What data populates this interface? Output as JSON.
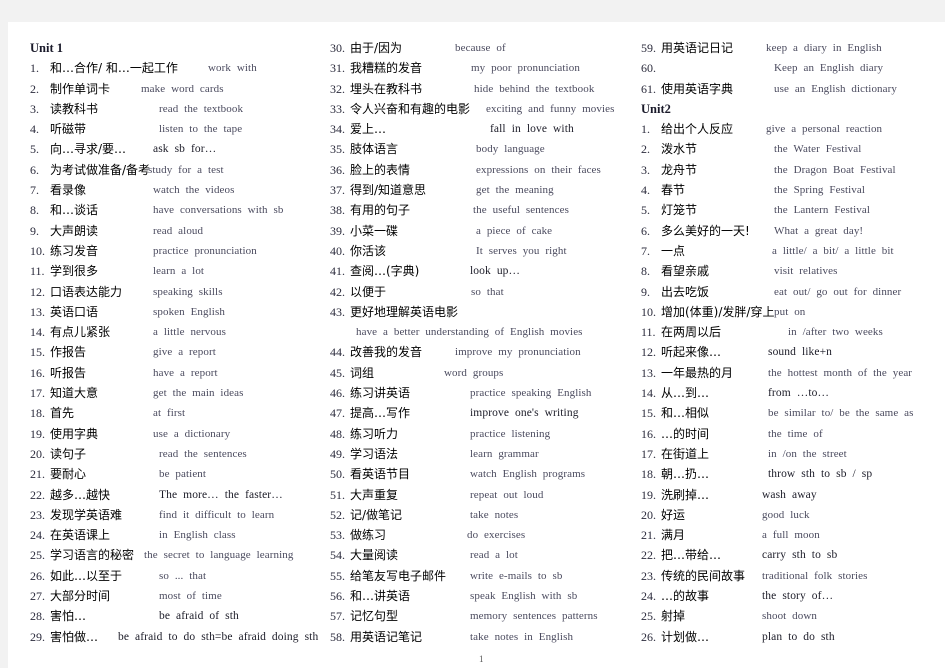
{
  "page": {
    "page_number": "1",
    "columns": [
      {
        "lines": [
          {
            "type": "heading",
            "text": "Unit  1"
          },
          {
            "n": "1.",
            "zh": "和…合作/ 和…一起工作",
            "en": "work  with"
          },
          {
            "n": "2.",
            "zh": "制作单词卡",
            "en": "make  word  cards"
          },
          {
            "n": "3.",
            "zh": "读教科书",
            "en": "read  the  textbook"
          },
          {
            "n": "4.",
            "zh": "听磁带",
            "en": "listen  to  the  tape"
          },
          {
            "n": "5.",
            "zh": "向…寻求/要…",
            "en": "ask  sb  for…",
            "dark": true
          },
          {
            "n": "6.",
            "zh": "为考试做准备/备考",
            "en": "study  for  a  test"
          },
          {
            "n": "7.",
            "zh": "看录像",
            "en": "watch  the  videos"
          },
          {
            "n": "8.",
            "zh": "和…谈话",
            "en": "have  conversations  with  sb"
          },
          {
            "n": "9.",
            "zh": "大声朗读",
            "en": "read  aloud"
          },
          {
            "n": "10.",
            "zh": "练习发音",
            "en": "practice  pronunciation"
          },
          {
            "n": "11.",
            "zh": "学到很多",
            "en": "learn  a  lot"
          },
          {
            "n": "12.",
            "zh": "口语表达能力",
            "en": "speaking  skills"
          },
          {
            "n": "13.",
            "zh": "英语口语",
            "en": "spoken  English"
          },
          {
            "n": "14.",
            "zh": "有点儿紧张",
            "en": "a  little  nervous"
          },
          {
            "n": "15.",
            "zh": "作报告",
            "en": "give  a  report"
          },
          {
            "n": "16.",
            "zh": "听报告",
            "en": "have  a  report"
          },
          {
            "n": "17.",
            "zh": "知道大意",
            "en": "get  the  main  ideas"
          },
          {
            "n": "18.",
            "zh": "首先",
            "en": "at  first"
          },
          {
            "n": "19.",
            "zh": "使用字典",
            "en": "use  a  dictionary"
          },
          {
            "n": "20.",
            "zh": "读句子",
            "en": "read  the  sentences"
          },
          {
            "n": "21.",
            "zh": "要耐心",
            "en": "be  patient"
          },
          {
            "n": "22.",
            "zh": "越多…越快",
            "en": "The  more…  the  faster…",
            "dark": true
          },
          {
            "n": "23.",
            "zh": "发现学英语难",
            "en": "find  it  difficult  to  learn"
          },
          {
            "n": "24.",
            "zh": "在英语课上",
            "en": "in  English  class"
          },
          {
            "n": "25.",
            "zh": "学习语言的秘密",
            "en": "the  secret  to  language  learning"
          },
          {
            "n": "26.",
            "zh": "如此…以至于",
            "en": "so  ...  that"
          },
          {
            "n": "27.",
            "zh": "大部分时间",
            "en": "most  of  time"
          },
          {
            "n": "28.",
            "zh": "害怕…",
            "en": "be  afraid  of  sth",
            "dark": true
          },
          {
            "n": "29.",
            "zh": "害怕做…",
            "en": "be  afraid  to  do  sth=be  afraid  doing  sth",
            "dark": true
          }
        ]
      },
      {
        "lines": [
          {
            "n": "30.",
            "zh": "由于/因为",
            "en": "because  of"
          },
          {
            "n": "31.",
            "zh": "我糟糕的发音",
            "en": "my  poor  pronunciation"
          },
          {
            "n": "32.",
            "zh": "埋头在教科书",
            "en": "hide  behind  the  textbook"
          },
          {
            "n": "33.",
            "zh": "令人兴奋和有趣的电影",
            "en": "exciting  and  funny  movies"
          },
          {
            "n": "34.",
            "zh": "爱上…",
            "en": "fall  in  love  with",
            "dark": true
          },
          {
            "n": "35.",
            "zh": "肢体语言",
            "en": "body  language"
          },
          {
            "n": "36.",
            "zh": "脸上的表情",
            "en": "expressions  on  their  faces"
          },
          {
            "n": "37.",
            "zh": "得到/知道意思",
            "en": "get  the  meaning"
          },
          {
            "n": "38.",
            "zh": "有用的句子",
            "en": "the  useful  sentences"
          },
          {
            "n": "39.",
            "zh": "小菜一碟",
            "en": "a  piece  of  cake"
          },
          {
            "n": "40.",
            "zh": "你活该",
            "en": "It  serves  you  right"
          },
          {
            "n": "41.",
            "zh": "查阅…(字典)",
            "en": "look  up…",
            "dark": true
          },
          {
            "n": "42.",
            "zh": "以便于",
            "en": "so  that"
          },
          {
            "n": "43.",
            "zh": "更好地理解英语电影",
            "en": ""
          },
          {
            "type": "continuation",
            "en": "have  a  better  understanding  of  English  movies"
          },
          {
            "n": "44.",
            "zh": "改善我的发音",
            "en": "improve  my  pronunciation"
          },
          {
            "n": "45.",
            "zh": "词组",
            "en": "word  groups"
          },
          {
            "n": "46.",
            "zh": "练习讲英语",
            "en": "practice  speaking  English"
          },
          {
            "n": "47.",
            "zh": "提高…写作",
            "en": "improve  one's  writing",
            "dark": true
          },
          {
            "n": "48.",
            "zh": "练习听力",
            "en": "practice  listening"
          },
          {
            "n": "49.",
            "zh": "学习语法",
            "en": "learn  grammar"
          },
          {
            "n": "50.",
            "zh": "看英语节目",
            "en": "watch  English  programs"
          },
          {
            "n": "51.",
            "zh": "大声重复",
            "en": "repeat  out  loud"
          },
          {
            "n": "52.",
            "zh": "记/做笔记",
            "en": "take  notes"
          },
          {
            "n": "53.",
            "zh": "做练习",
            "en": "do  exercises"
          },
          {
            "n": "54.",
            "zh": "大量阅读",
            "en": "read  a  lot"
          },
          {
            "n": "55.",
            "zh": "给笔友写电子邮件",
            "en": "write  e-mails  to  sb"
          },
          {
            "n": "56.",
            "zh": "和…讲英语",
            "en": "speak  English  with  sb"
          },
          {
            "n": "57.",
            "zh": "记忆句型",
            "en": "memory  sentences  patterns"
          },
          {
            "n": "58.",
            "zh": "用英语记笔记",
            "en": "take  notes  in  English"
          }
        ]
      },
      {
        "lines": [
          {
            "n": "59.",
            "zh": "用英语记日记",
            "en": "keep  a  diary  in  English"
          },
          {
            "n": "60.",
            "zh": "",
            "en": "Keep  an  English  diary"
          },
          {
            "n": "61.",
            "zh": "使用英语字典",
            "en": "use  an  English  dictionary"
          },
          {
            "type": "heading",
            "text": "Unit2"
          },
          {
            "n": "1.",
            "zh": "给出个人反应",
            "en": "give  a  personal  reaction"
          },
          {
            "n": "2.",
            "zh": "泼水节",
            "en": "the  Water  Festival"
          },
          {
            "n": "3.",
            "zh": "龙舟节",
            "en": "the  Dragon  Boat  Festival"
          },
          {
            "n": "4.",
            "zh": "春节",
            "en": "the  Spring  Festival"
          },
          {
            "n": "5.",
            "zh": "灯笼节",
            "en": "the  Lantern  Festival"
          },
          {
            "n": "6.",
            "zh": "多么美好的一天!",
            "en": "What  a  great  day!"
          },
          {
            "n": "7.",
            "zh": "一点",
            "en": "a  little/  a  bit/  a  little  bit"
          },
          {
            "n": "8.",
            "zh": "看望亲戚",
            "en": "visit  relatives"
          },
          {
            "n": "9.",
            "zh": "出去吃饭",
            "en": "eat  out/  go  out  for  dinner"
          },
          {
            "n": "10.",
            "zh": "增加(体重)/发胖/穿上",
            "en": "put  on"
          },
          {
            "n": "11.",
            "zh": "在两周以后",
            "en": "in  /after  two  weeks"
          },
          {
            "n": "12.",
            "zh": "听起来像…",
            "en": "sound  like+n",
            "dark": true
          },
          {
            "n": "13.",
            "zh": "一年最热的月",
            "en": "the  hottest  month  of  the  year"
          },
          {
            "n": "14.",
            "zh": "从…到…",
            "en": "from  …to…",
            "dark": true
          },
          {
            "n": "15.",
            "zh": "和…相似",
            "en": "be  similar  to/  be  the  same  as"
          },
          {
            "n": "16.",
            "zh": "…的时间",
            "en": "the  time  of"
          },
          {
            "n": "17.",
            "zh": "在街道上",
            "en": "in  /on  the  street"
          },
          {
            "n": "18.",
            "zh": "朝…扔…",
            "en": "throw  sth  to  sb  /  sp",
            "dark": true
          },
          {
            "n": "19.",
            "zh": "洗刷掉…",
            "en": "wash  away",
            "dark": true
          },
          {
            "n": "20.",
            "zh": "好运",
            "en": "good  luck"
          },
          {
            "n": "21.",
            "zh": "满月",
            "en": "a  full  moon"
          },
          {
            "n": "22.",
            "zh": "把…带给…",
            "en": "carry  sth  to  sb",
            "dark": true
          },
          {
            "n": "23.",
            "zh": "传统的民间故事",
            "en": "traditional  folk  stories"
          },
          {
            "n": "24.",
            "zh": "…的故事",
            "en": "the  story  of…",
            "dark": true
          },
          {
            "n": "25.",
            "zh": "射掉",
            "en": "shoot  down"
          },
          {
            "n": "26.",
            "zh": "计划做…",
            "en": "plan  to  do  sth",
            "dark": true
          }
        ]
      }
    ]
  }
}
